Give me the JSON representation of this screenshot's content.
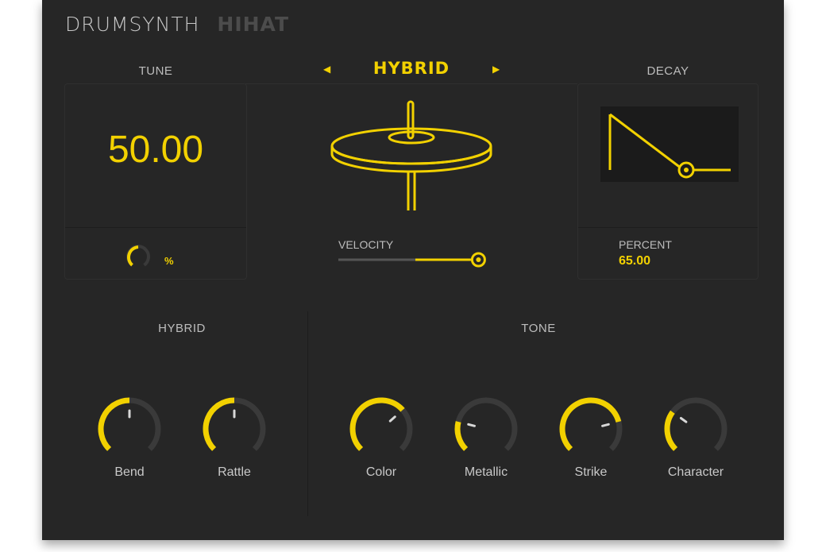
{
  "brand": {
    "title": "DRUMSYNTH",
    "subtitle": "HIHAT"
  },
  "tune": {
    "label": "TUNE",
    "value": "50.00",
    "unit": "%"
  },
  "mode": {
    "name": "HYBRID",
    "prev_icon": "triangle-left-icon",
    "next_icon": "triangle-right-icon"
  },
  "velocity": {
    "label": "VELOCITY",
    "level": 0.98
  },
  "decay": {
    "label": "DECAY",
    "percent_label": "PERCENT",
    "percent_value": "65.00"
  },
  "hybrid_section": {
    "title": "HYBRID",
    "knobs": [
      {
        "label": "Bend",
        "value": 0.5
      },
      {
        "label": "Rattle",
        "value": 0.5
      }
    ]
  },
  "tone_section": {
    "title": "TONE",
    "knobs": [
      {
        "label": "Color",
        "value": 0.68
      },
      {
        "label": "Metallic",
        "value": 0.22
      },
      {
        "label": "Strike",
        "value": 0.78
      },
      {
        "label": "Character",
        "value": 0.3
      }
    ]
  },
  "colors": {
    "accent": "#f2d100",
    "panel": "#262626",
    "knob_track": "#3a3a3a"
  }
}
